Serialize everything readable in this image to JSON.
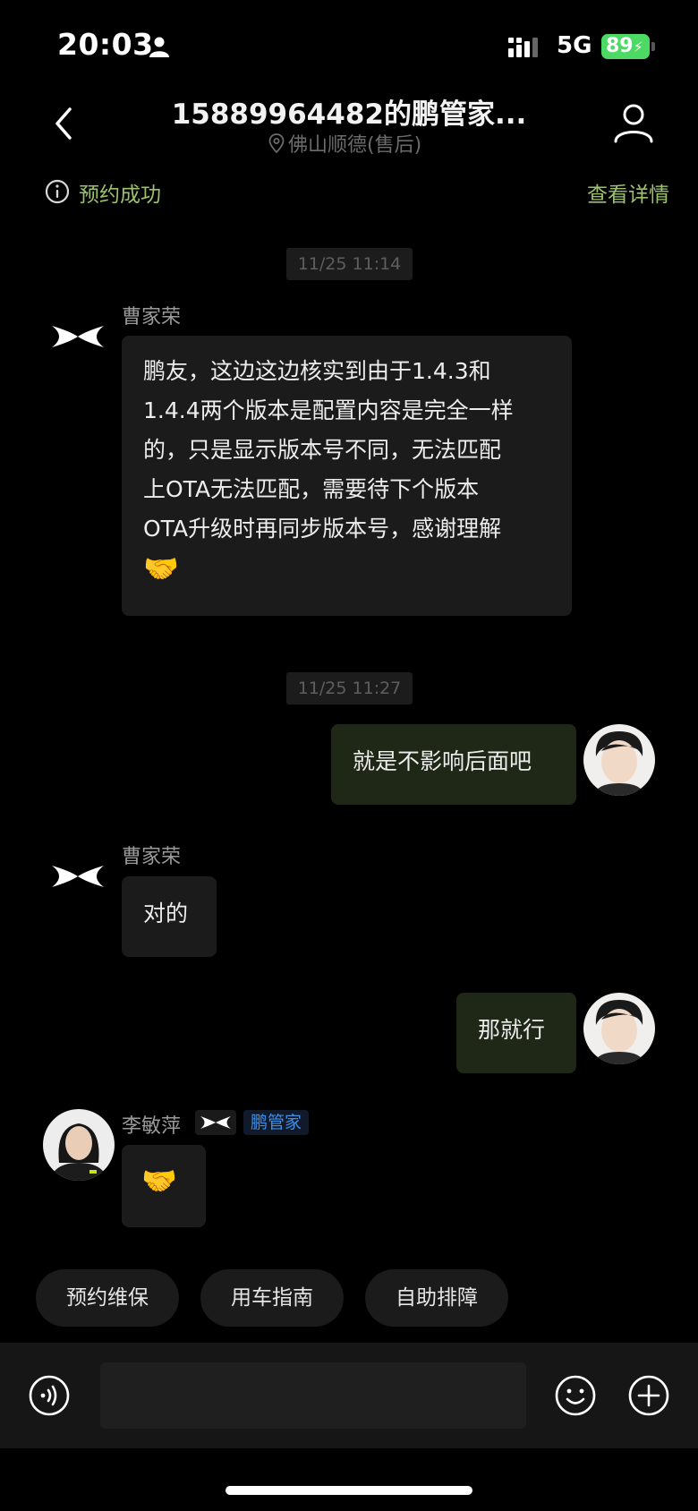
{
  "status_bar": {
    "time": "20:03",
    "network": "5G",
    "battery": "89"
  },
  "header": {
    "title": "15889964482的鹏管家...",
    "subtitle": "佛山顺德(售后)"
  },
  "banner": {
    "status": "预约成功",
    "link": "查看详情",
    "accent_color": "#9bc26b"
  },
  "messages": [
    {
      "timestamp": "11/25 11:14"
    },
    {
      "sender": "曹家荣",
      "lines": [
        "鹏友，这边这边核实到由于1.4.3和",
        "1.4.4两个版本是配置内容是完全一样",
        "的，只是显示版本号不同，无法匹配",
        "上OTA无法匹配，需要待下个版本",
        "OTA升级时再同步版本号，感谢理解"
      ],
      "emoji": "🤝"
    },
    {
      "timestamp": "11/25 11:27"
    },
    {
      "text": "就是不影响后面吧"
    },
    {
      "sender": "曹家荣",
      "text": "对的"
    },
    {
      "text": "那就行"
    },
    {
      "sender": "李敏萍",
      "tag": "鹏管家",
      "emoji": "🤝"
    }
  ],
  "quick_actions": [
    "预约维保",
    "用车指南",
    "自助排障"
  ],
  "input": {
    "placeholder": ""
  }
}
